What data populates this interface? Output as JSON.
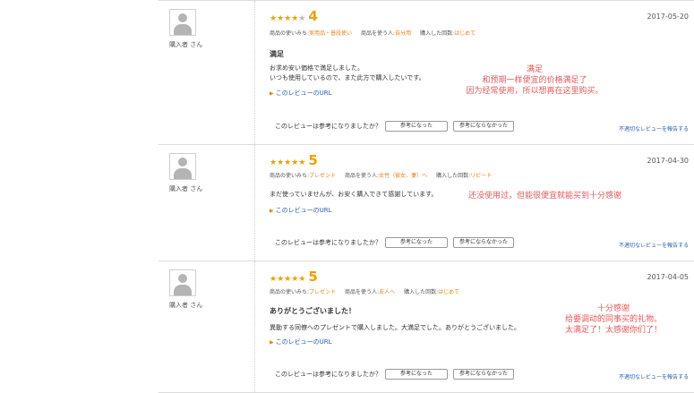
{
  "reviews": [
    {
      "reviewer": "購入者 さん",
      "stars_filled": 4,
      "stars_empty": 1,
      "stars_text": "★★★★",
      "stars_off_text": "★",
      "score": "4",
      "date": "2017-05-20",
      "meta": {
        "usage_label": "商品の使いみち:",
        "usage_value": "実用品・普段使い",
        "user_label": "商品を使う人:",
        "user_value": "自分用",
        "count_label": "購入した回数:",
        "count_value": "はじめて"
      },
      "title": "満足",
      "body": [
        "お求め安い価格で満足しました。",
        "いつも使用しているので、また此方で購入したいです。"
      ],
      "url_text": "このレビューのURL",
      "annotation": [
        "满足",
        "和预期一样便宜的价格满足了",
        "因为经常使用，所以想再在这里购买。"
      ],
      "helpful_question": "このレビューは参考になりましたか？",
      "helpful_yes": "参考になった",
      "helpful_no": "参考にならなかった",
      "report": "不適切なレビューを報告する"
    },
    {
      "reviewer": "購入者 さん",
      "stars_filled": 5,
      "stars_empty": 0,
      "stars_text": "★★★★★",
      "stars_off_text": "",
      "score": "5",
      "date": "2017-04-30",
      "meta": {
        "usage_label": "商品の使いみち:",
        "usage_value": "プレゼント",
        "user_label": "商品を使う人:",
        "user_value": "女性（彼女、妻）へ",
        "count_label": "購入した回数:",
        "count_value": "リピート"
      },
      "title": "",
      "body": [
        "まだ使っていませんが、お安く購入できて感謝しています。"
      ],
      "url_text": "このレビューのURL",
      "annotation": [
        "还没使用过，但能很便宜就能买到十分感谢"
      ],
      "helpful_question": "このレビューは参考になりましたか？",
      "helpful_yes": "参考になった",
      "helpful_no": "参考にならなかった",
      "report": "不適切なレビューを報告する"
    },
    {
      "reviewer": "購入者 さん",
      "stars_filled": 5,
      "stars_empty": 0,
      "stars_text": "★★★★★",
      "stars_off_text": "",
      "score": "5",
      "date": "2017-04-05",
      "meta": {
        "usage_label": "商品の使いみち:",
        "usage_value": "プレゼント",
        "user_label": "商品を使う人:",
        "user_value": "友人へ",
        "count_label": "購入した回数:",
        "count_value": "はじめて"
      },
      "title": "ありがとうございました！",
      "body": [
        "異動する同僚へのプレゼントで購入しました。大満足でした。ありがとうございました。"
      ],
      "url_text": "このレビューのURL",
      "annotation": [
        "十分感谢",
        "给要调动的同事买的礼物。",
        "太满足了！太感谢你们了！"
      ],
      "helpful_question": "このレビューは参考になりましたか？",
      "helpful_yes": "参考になった",
      "helpful_no": "参考にならなかった",
      "report": "不適切なレビューを報告する"
    }
  ]
}
